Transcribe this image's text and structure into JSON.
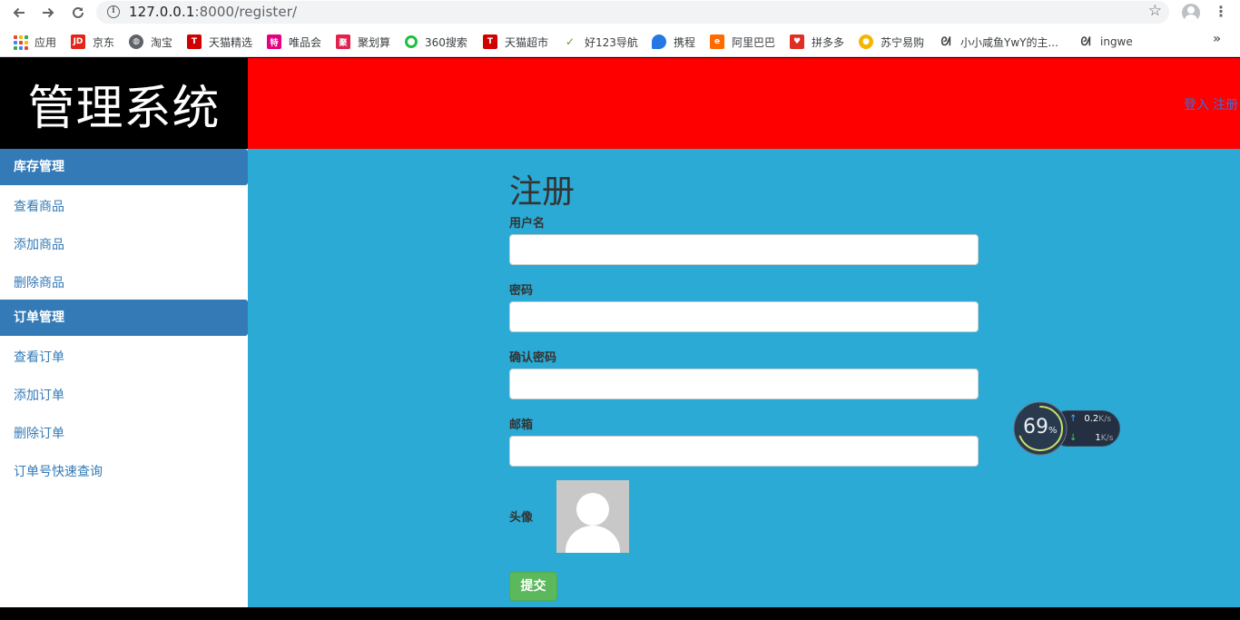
{
  "browser": {
    "url_host": "127.0.0.1",
    "url_rest": ":8000/register/",
    "bookmarks": [
      {
        "label": "应用",
        "icon": "apps-grid-icon"
      },
      {
        "label": "京东",
        "icon": "jd-icon",
        "icon_text": "JD",
        "color": "#e1251b"
      },
      {
        "label": "淘宝",
        "icon": "globe-icon",
        "color": "#5f6368"
      },
      {
        "label": "天猫精选",
        "icon": "tmall-icon",
        "icon_text": "T",
        "color": "#d00000"
      },
      {
        "label": "唯品会",
        "icon": "vip-icon",
        "icon_text": "特",
        "color": "#e4007f"
      },
      {
        "label": "聚划算",
        "icon": "juhuasuan-icon",
        "icon_text": "聚",
        "color": "#e0224d"
      },
      {
        "label": "360搜索",
        "icon": "360-icon",
        "color": "#1fbf3f"
      },
      {
        "label": "天猫超市",
        "icon": "tmall-market-icon",
        "icon_text": "T",
        "color": "#d00000"
      },
      {
        "label": "好123导航",
        "icon": "hao123-icon",
        "color": "#5c9e2e"
      },
      {
        "label": "携程",
        "icon": "ctrip-icon",
        "color": "#2577e3"
      },
      {
        "label": "阿里巴巴",
        "icon": "alibaba-icon",
        "color": "#ff6a00"
      },
      {
        "label": "拼多多",
        "icon": "pinduoduo-icon",
        "color": "#e02e24"
      },
      {
        "label": "苏宁易购",
        "icon": "suning-icon",
        "color": "#f7b500"
      },
      {
        "label": "小小咸鱼YwY的主...",
        "icon": "bird-icon",
        "color": "#444"
      },
      {
        "label": "ingwe",
        "icon": "bird-icon",
        "color": "#444"
      }
    ]
  },
  "header": {
    "logo": "管理系统",
    "login": "登入",
    "register": "注册"
  },
  "sidebar": {
    "inventory_title": "库存管理",
    "inventory_items": [
      "查看商品",
      "添加商品",
      "删除商品"
    ],
    "order_title": "订单管理",
    "order_items": [
      "查看订单",
      "添加订单",
      "删除订单",
      "订单号快速查询"
    ]
  },
  "form": {
    "title": "注册",
    "username_label": "用户名",
    "password_label": "密码",
    "confirm_label": "确认密码",
    "email_label": "邮箱",
    "avatar_label": "头像",
    "submit": "提交"
  },
  "net_widget": {
    "percent": "69",
    "percent_unit": "%",
    "percent_value": 69,
    "up": "0.2",
    "down": "1",
    "unit": "K/s"
  }
}
